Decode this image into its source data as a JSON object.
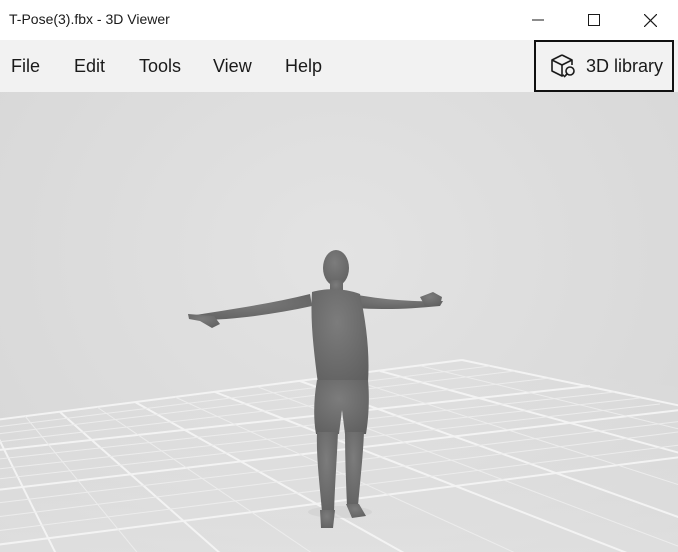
{
  "window": {
    "title": "T-Pose(3).fbx - 3D Viewer",
    "controls": {
      "minimize_icon": "minimize-icon",
      "maximize_icon": "maximize-icon",
      "close_icon": "close-icon"
    }
  },
  "menu": {
    "items": [
      {
        "label": "File"
      },
      {
        "label": "Edit"
      },
      {
        "label": "Tools"
      },
      {
        "label": "View"
      },
      {
        "label": "Help"
      }
    ]
  },
  "library_button": {
    "label": "3D library",
    "icon": "3d-library-icon"
  },
  "viewport": {
    "model_name": "T-Pose(3).fbx",
    "background_color": "#dddddd",
    "model_color": "#6e6e6e",
    "grid_color": "#f4f4f4"
  }
}
